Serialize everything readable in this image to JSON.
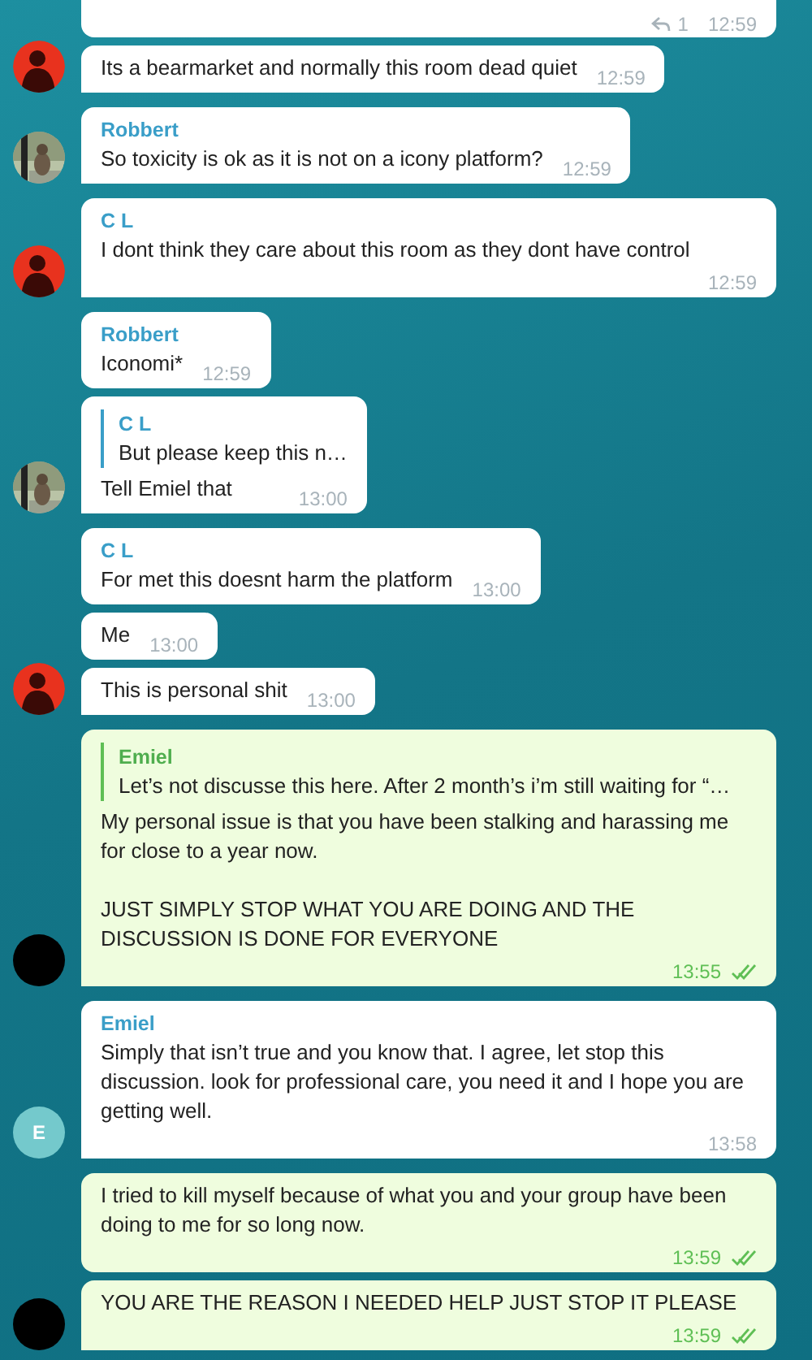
{
  "groups": [
    {
      "avatar": {
        "kind": "figure"
      },
      "messages": [
        {
          "outgoing": false,
          "replies": "1",
          "time": "12:59"
        },
        {
          "outgoing": false,
          "text": "Its a bearmarket and normally this room dead quiet",
          "time": "12:59"
        }
      ]
    },
    {
      "avatar": {
        "kind": "animal"
      },
      "messages": [
        {
          "outgoing": false,
          "name": "Robbert",
          "text": "So toxicity is ok as it is not on a icony platform?",
          "time": "12:59"
        }
      ]
    },
    {
      "avatar": {
        "kind": "figure"
      },
      "messages": [
        {
          "outgoing": false,
          "name": "C L",
          "text": "I dont think they care about this room as they dont have control",
          "time": "12:59"
        }
      ]
    },
    {
      "avatar": {
        "kind": "animal"
      },
      "messages": [
        {
          "outgoing": false,
          "name": "Robbert",
          "text": "Iconomi*",
          "time": "12:59"
        },
        {
          "outgoing": false,
          "reply": {
            "name": "C L",
            "text": "But please keep this n…"
          },
          "text": "Tell Emiel that",
          "time": "13:00"
        }
      ]
    },
    {
      "avatar": {
        "kind": "figure"
      },
      "messages": [
        {
          "outgoing": false,
          "name": "C L",
          "text": "For met this doesnt harm the platform",
          "time": "13:00"
        },
        {
          "outgoing": false,
          "text": "Me",
          "time": "13:00"
        },
        {
          "outgoing": false,
          "text": "This is personal shit",
          "time": "13:00"
        }
      ]
    },
    {
      "avatar": {
        "kind": "blank"
      },
      "messages": [
        {
          "outgoing": true,
          "read": true,
          "reply": {
            "name": "Emiel",
            "text": "Let’s not discusse this here. After 2 month’s i’m still waiting for “…"
          },
          "text": "My personal issue is that you have been stalking and harassing me for close to a year now.\n\nJUST SIMPLY STOP WHAT YOU ARE DOING AND THE DISCUSSION IS DONE FOR EVERYONE",
          "time": "13:55"
        }
      ]
    },
    {
      "avatar": {
        "kind": "initial",
        "initial": "E",
        "color": "#74c9cc"
      },
      "messages": [
        {
          "outgoing": false,
          "name": "Emiel",
          "text": "Simply that isn’t true and you know that. I agree, let stop this discussion. look for professional care, you need it and I hope you are getting well.",
          "time": "13:58"
        }
      ]
    },
    {
      "avatar": {
        "kind": "blank"
      },
      "messages": [
        {
          "outgoing": true,
          "read": true,
          "text": "I tried to kill myself because of what you and your group have been doing to me for so long now.",
          "time": "13:59"
        },
        {
          "outgoing": true,
          "read": true,
          "text": "YOU ARE THE REASON I NEEDED HELP JUST STOP IT PLEASE",
          "time": "13:59"
        }
      ]
    }
  ]
}
